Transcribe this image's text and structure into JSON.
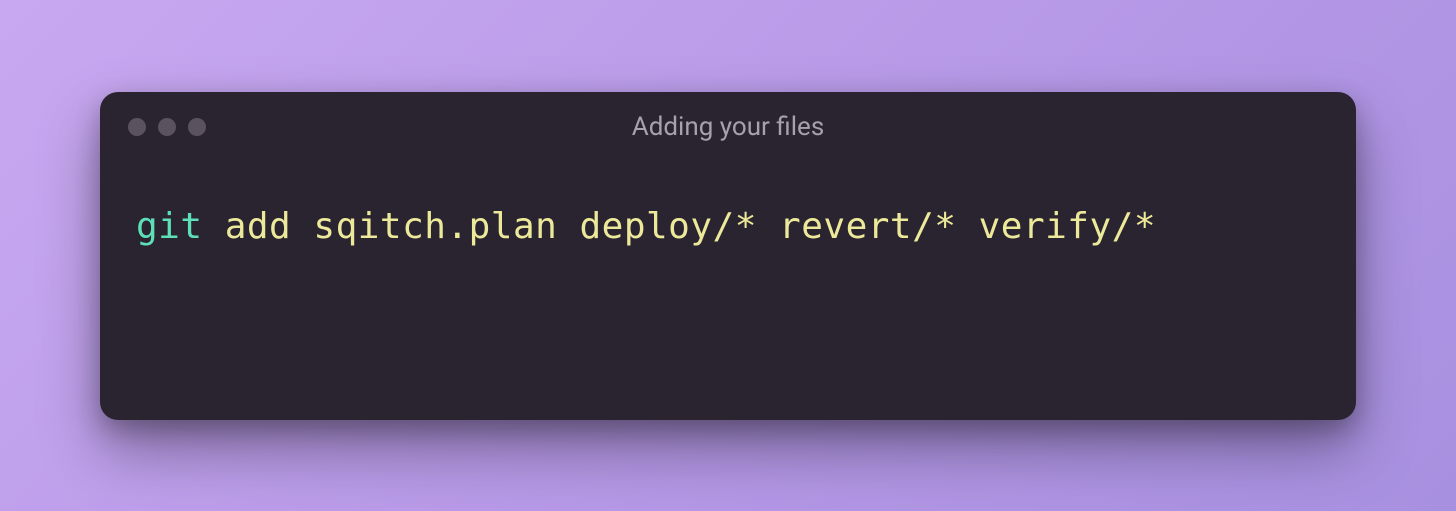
{
  "window": {
    "title": "Adding your files"
  },
  "command": {
    "program": "git",
    "args": " add sqitch.plan deploy/* revert/* verify/*"
  }
}
